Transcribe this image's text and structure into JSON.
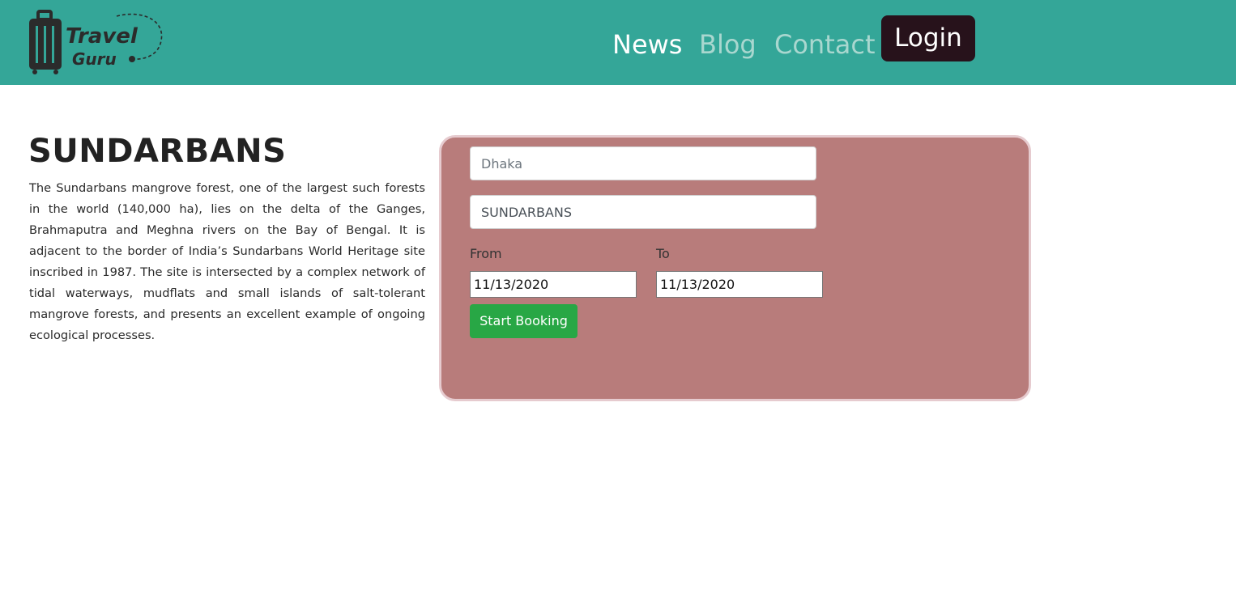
{
  "brand": {
    "logo_line1": "Travel",
    "logo_line2": "Guru",
    "icon": "suitcase-icon"
  },
  "nav": {
    "links": [
      {
        "label": "News",
        "active": true
      },
      {
        "label": "Blog",
        "active": false
      },
      {
        "label": "Contact",
        "active": false
      }
    ],
    "login_label": "Login"
  },
  "place": {
    "title": "SUNDARBANS",
    "description": "The Sundarbans mangrove forest, one of the largest such forests in the world (140,000 ha), lies on the delta of the Ganges, Brahmaputra and Meghna rivers on the Bay of Bengal. It is adjacent to the border of India’s Sundarbans World Heritage site inscribed in 1987. The site is intersected by a complex network of tidal waterways, mudflats and small islands of salt-tolerant mangrove forests, and presents an excellent example of ongoing ecological processes."
  },
  "booking": {
    "origin_placeholder": "Dhaka",
    "origin_value": "",
    "destination_value": "SUNDARBANS",
    "from_label": "From",
    "to_label": "To",
    "from_date": "11/13/2020",
    "to_date": "11/13/2020",
    "submit_label": "Start Booking"
  },
  "colors": {
    "navbar": "#34a698",
    "login_button": "#27121b",
    "card_background": "#b87c7b",
    "card_border": "#e6cbcf",
    "submit_button": "#28a745"
  }
}
